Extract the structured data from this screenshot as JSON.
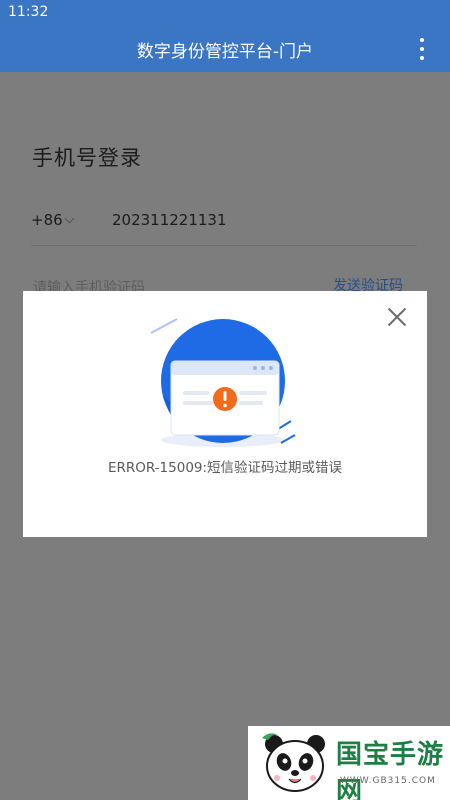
{
  "status_bar": {
    "time": "11:32"
  },
  "app_bar": {
    "title": "数字身份管控平台-门户"
  },
  "login": {
    "title": "手机号登录",
    "country_code": "+86",
    "phone_value": "202311221131",
    "code_placeholder": "请输入手机验证码",
    "send_code_label": "发送验证码"
  },
  "dialog": {
    "message": "ERROR-15009:短信验证码过期或错误"
  },
  "watermark": {
    "brand": "国宝手游网",
    "url": "WWW.GB315.COM"
  },
  "colors": {
    "app_bar": "#3b76c5",
    "overlay": "#7d7d7d",
    "illustration_blue": "#1f6be6",
    "warning_orange": "#f26a1b",
    "watermark_green": "#1d7f43"
  },
  "icons": [
    "more-vertical-icon",
    "chevron-down-icon",
    "close-icon",
    "error-warning-illustration",
    "panda-logo"
  ]
}
